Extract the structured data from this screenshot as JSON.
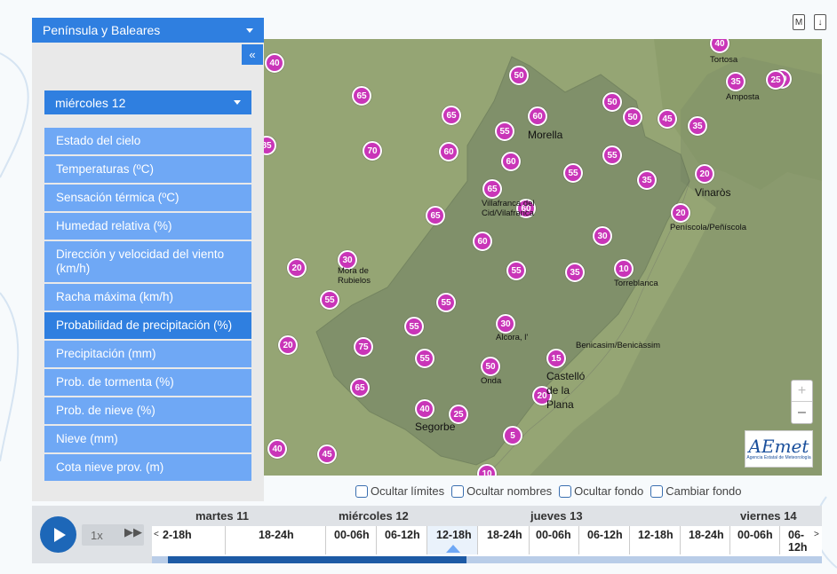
{
  "header_icons": [
    {
      "name": "map-mode-icon",
      "glyph": "M"
    },
    {
      "name": "download-icon",
      "glyph": "↓"
    }
  ],
  "region": {
    "selected": "Península y Baleares"
  },
  "collapse_label": "«",
  "day": {
    "selected": "miércoles 12"
  },
  "menu": [
    {
      "label": "Estado del cielo",
      "active": false
    },
    {
      "label": "Temperaturas (ºC)",
      "active": false
    },
    {
      "label": "Sensación térmica (ºC)",
      "active": false
    },
    {
      "label": "Humedad relativa (%)",
      "active": false
    },
    {
      "label": "Dirección y velocidad del viento (km/h)",
      "active": false
    },
    {
      "label": "Racha máxima (km/h)",
      "active": false
    },
    {
      "label": "Probabilidad de precipitación (%)",
      "active": true
    },
    {
      "label": "Precipitación (mm)",
      "active": false
    },
    {
      "label": "Prob. de tormenta (%)",
      "active": false
    },
    {
      "label": "Prob. de nieve (%)",
      "active": false
    },
    {
      "label": "Nieve (mm)",
      "active": false
    },
    {
      "label": "Cota nieve prov. (m)",
      "active": false
    }
  ],
  "markers": [
    "40",
    "40",
    "10",
    "35",
    "50",
    "65",
    "50",
    "65",
    "60",
    "55",
    "50",
    "45",
    "35",
    "85",
    "70",
    "60",
    "60",
    "55",
    "55",
    "35",
    "20",
    "65",
    "65",
    "60",
    "20",
    "60",
    "30",
    "30",
    "20",
    "55",
    "35",
    "10",
    "55",
    "55",
    "30",
    "55",
    "75",
    "20",
    "55",
    "50",
    "25",
    "15",
    "65",
    "20",
    "40",
    "25",
    "5",
    "40",
    "45",
    "10"
  ],
  "towns": [
    "Tortosa",
    "Amposta",
    "Morella",
    "Vinaròs",
    "Villafranca del Cid/Vilafranca",
    "Peníscola/Peñíscola",
    "Mora de Rubielos",
    "Torreblanca",
    "Alcora, l'",
    "Benicasim/Benicàssim",
    "Onda",
    "Castelló de la Plana",
    "Segorbe"
  ],
  "zoom": {
    "in": "+",
    "out": "–"
  },
  "logo": {
    "main": "AEmet",
    "sub": "Agencia Estatal de Meteorología"
  },
  "checks": [
    "Ocultar límites",
    "Ocultar nombres",
    "Ocultar fondo",
    "Cambiar fondo"
  ],
  "player": {
    "speed": "1x",
    "ff": "▶▶"
  },
  "timeline": {
    "days": [
      "martes 11",
      "miércoles 12",
      "jueves 13",
      "viernes 14"
    ],
    "slots": [
      "2-18h",
      "18-24h",
      "00-06h",
      "06-12h",
      "12-18h",
      "18-24h",
      "00-06h",
      "06-12h",
      "12-18h",
      "18-24h",
      "00-06h",
      "06-12h"
    ],
    "active_slot": "12-18h",
    "prev": "<",
    "next": ">",
    "progress": 0.47
  },
  "colors": {
    "accent": "#2f7fe0",
    "menu": "#6fa8f5",
    "marker": "#c935b8"
  }
}
